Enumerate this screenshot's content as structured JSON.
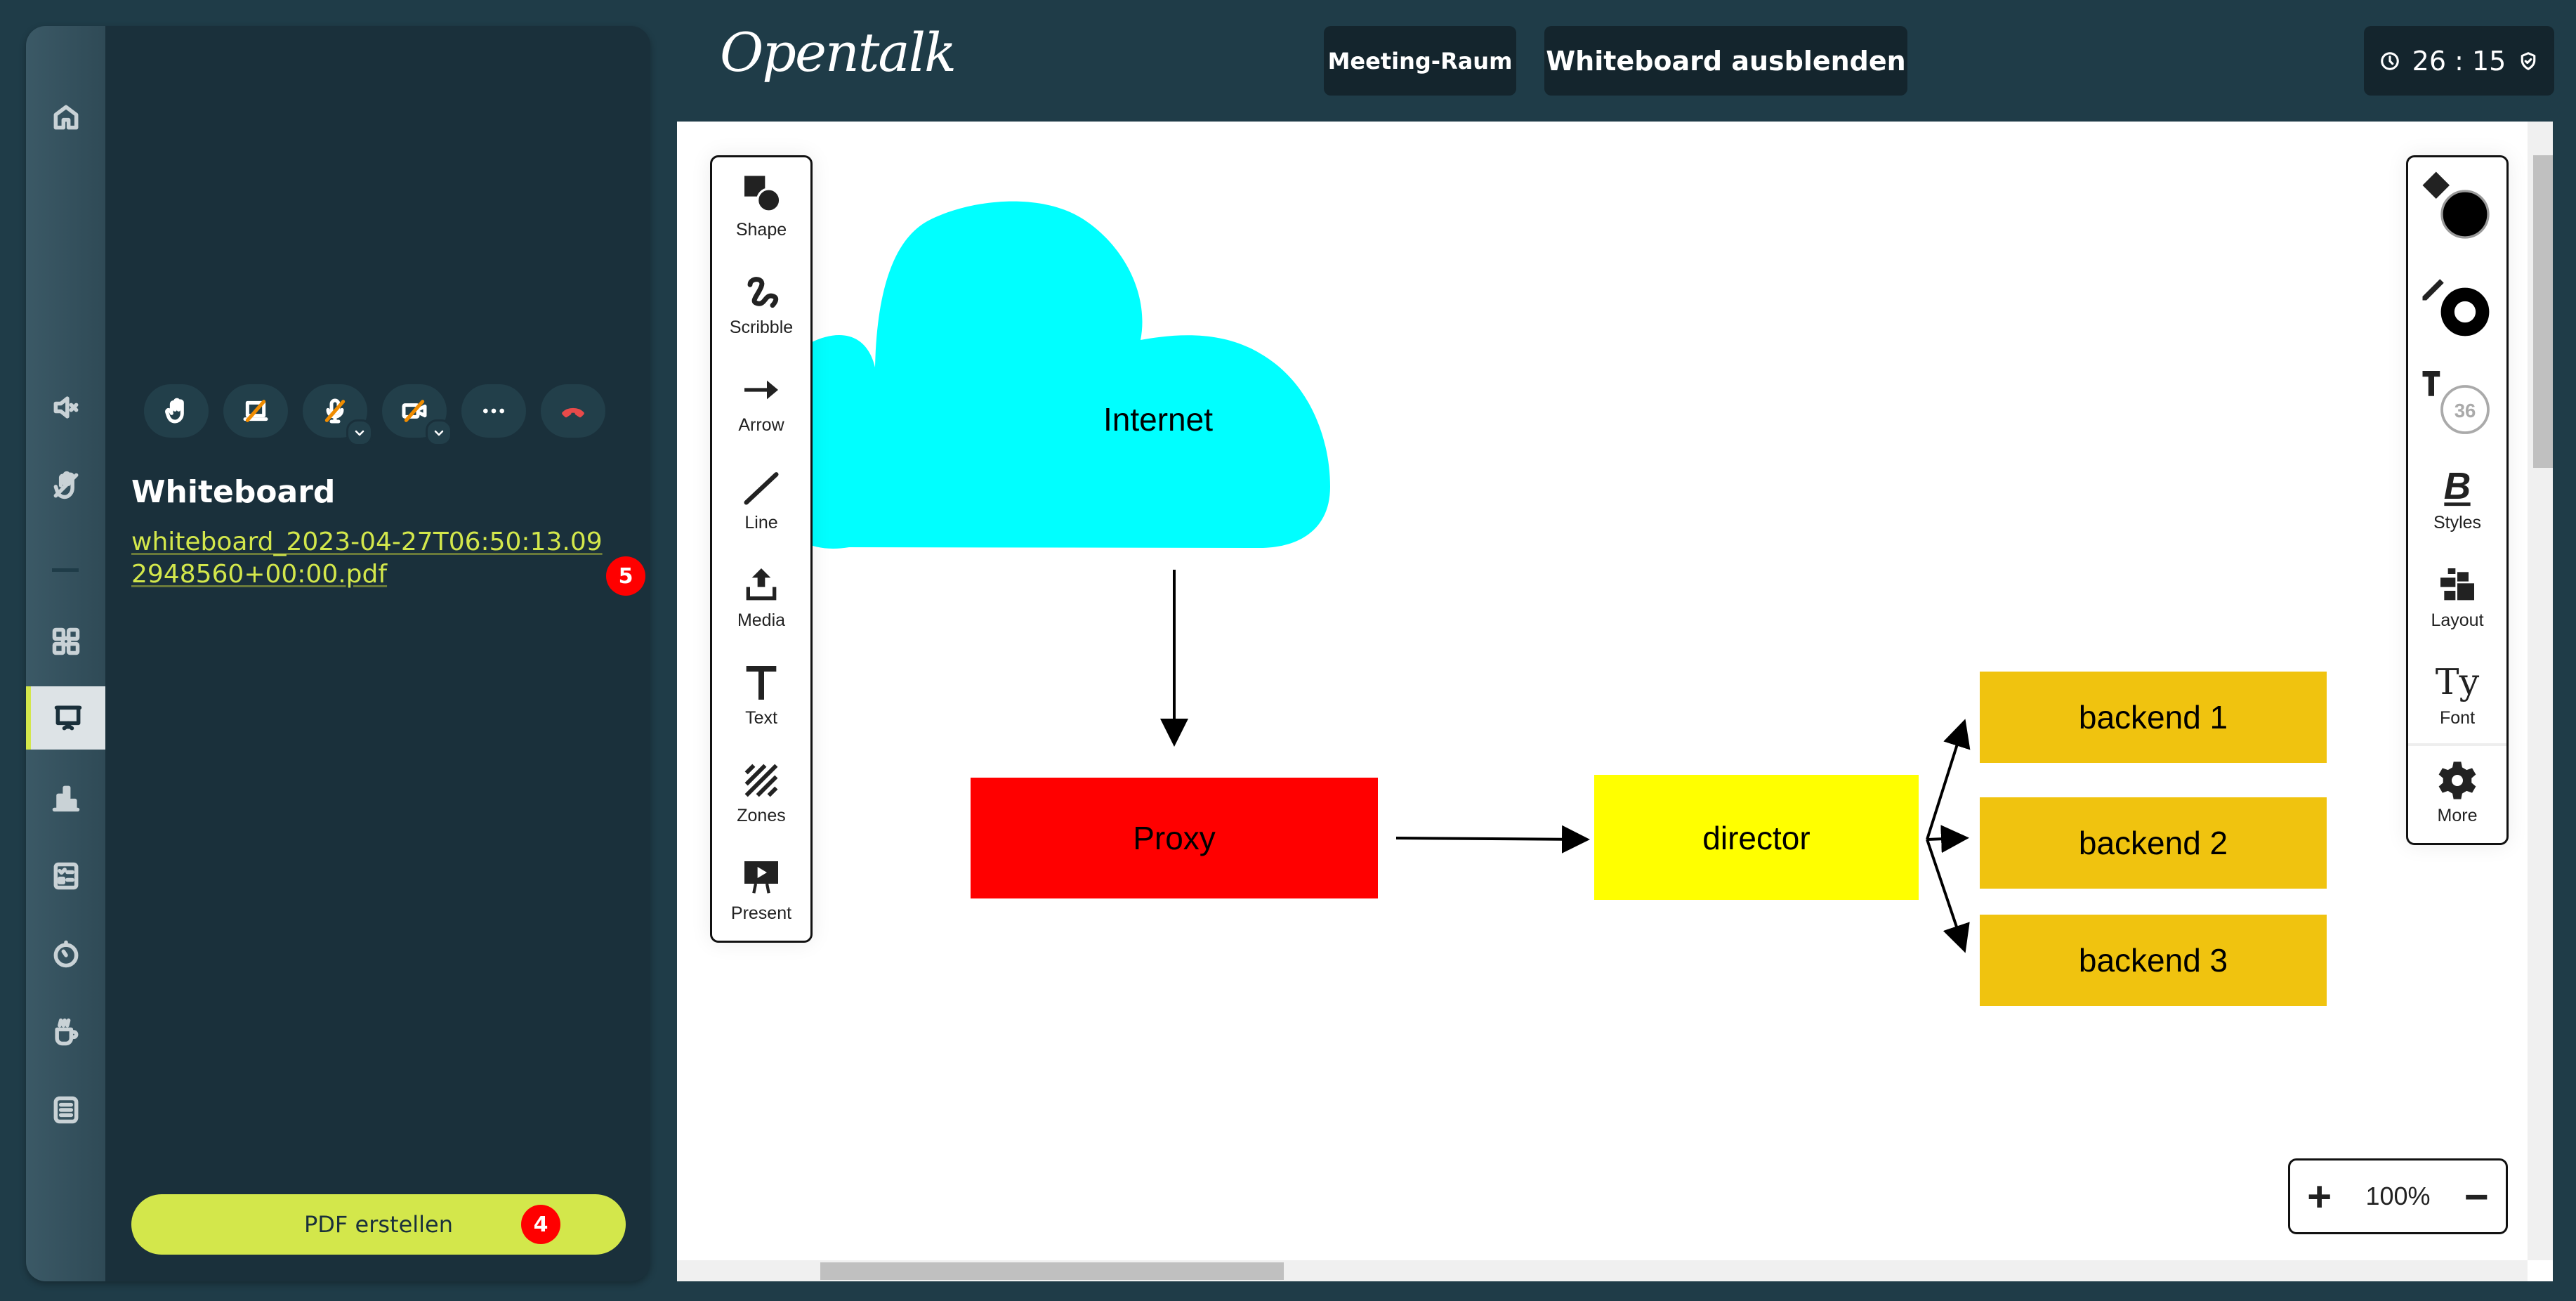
{
  "header": {
    "logo": "Opentalk",
    "meeting_room_label": "Meeting-Raum",
    "hide_whiteboard_label": "Whiteboard ausblenden",
    "timer": "26 : 15"
  },
  "sidebar": {
    "rail_items": [
      {
        "name": "home",
        "icon": "home-icon"
      },
      {
        "name": "mute-all",
        "icon": "speaker-mute-icon"
      },
      {
        "name": "lower-hands",
        "icon": "hand-off-icon"
      },
      {
        "name": "breakout-rooms",
        "icon": "rooms-icon"
      },
      {
        "name": "whiteboard",
        "icon": "whiteboard-icon",
        "active": true
      },
      {
        "name": "polls",
        "icon": "chart-icon"
      },
      {
        "name": "votes",
        "icon": "checklist-icon"
      },
      {
        "name": "timer",
        "icon": "timer-icon"
      },
      {
        "name": "coffee-break",
        "icon": "coffee-icon"
      },
      {
        "name": "protocol",
        "icon": "document-icon"
      }
    ],
    "controls": [
      {
        "name": "raise-hand",
        "icon": "hand-icon"
      },
      {
        "name": "screen-share",
        "icon": "screen-share-off-icon"
      },
      {
        "name": "microphone",
        "icon": "mic-off-icon",
        "has_menu": true
      },
      {
        "name": "camera",
        "icon": "camera-off-icon",
        "has_menu": true
      },
      {
        "name": "more",
        "icon": "more-icon"
      },
      {
        "name": "hang-up",
        "icon": "hang-up-icon"
      }
    ],
    "whiteboard_title": "Whiteboard",
    "pdf_link": "whiteboard_2023-04-27T06:50:13.092948560+00:00.pdf",
    "pdf_link_badge": "5",
    "create_pdf_label": "PDF erstellen",
    "create_pdf_badge": "4",
    "colors": {
      "accent": "#d3e74b",
      "badge": "#ff0000",
      "panel": "#1a303b"
    }
  },
  "whiteboard": {
    "left_tools": [
      {
        "label": "Shape",
        "icon": "shape-icon"
      },
      {
        "label": "Scribble",
        "icon": "scribble-icon"
      },
      {
        "label": "Arrow",
        "icon": "arrow-icon"
      },
      {
        "label": "Line",
        "icon": "line-icon"
      },
      {
        "label": "Media",
        "icon": "upload-icon"
      },
      {
        "label": "Text",
        "icon": "text-icon"
      },
      {
        "label": "Zones",
        "icon": "zones-icon"
      },
      {
        "label": "Present",
        "icon": "present-icon"
      }
    ],
    "right_tools": [
      {
        "label": "",
        "icon": "fill-color-icon",
        "value": "#000000"
      },
      {
        "label": "",
        "icon": "stroke-color-icon",
        "value": "#000000"
      },
      {
        "label": "",
        "icon": "font-size-icon",
        "value": "36"
      },
      {
        "label": "Styles",
        "icon": "bold-icon"
      },
      {
        "label": "Layout",
        "icon": "layout-icon"
      },
      {
        "label": "Font",
        "icon": "font-icon"
      },
      {
        "label": "More",
        "icon": "gear-icon"
      }
    ],
    "zoom": "100%",
    "diagram": {
      "nodes": [
        {
          "id": "internet",
          "label": "Internet",
          "shape": "cloud",
          "color": "#00ffff"
        },
        {
          "id": "proxy",
          "label": "Proxy",
          "shape": "rect",
          "color": "#ff0000"
        },
        {
          "id": "director",
          "label": "director",
          "shape": "rect",
          "color": "#ffff00"
        },
        {
          "id": "backend1",
          "label": "backend 1",
          "shape": "rect",
          "color": "#f0c30f"
        },
        {
          "id": "backend2",
          "label": "backend 2",
          "shape": "rect",
          "color": "#f0c30f"
        },
        {
          "id": "backend3",
          "label": "backend 3",
          "shape": "rect",
          "color": "#f0c30f"
        }
      ],
      "edges": [
        {
          "from": "internet",
          "to": "proxy"
        },
        {
          "from": "proxy",
          "to": "director"
        },
        {
          "from": "director",
          "to": "backend1"
        },
        {
          "from": "director",
          "to": "backend2"
        },
        {
          "from": "director",
          "to": "backend3"
        }
      ]
    }
  }
}
